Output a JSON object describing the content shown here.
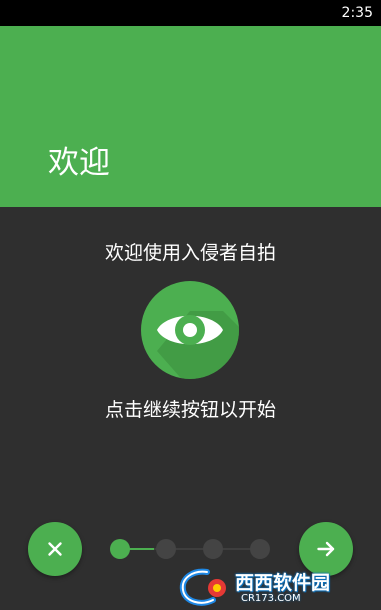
{
  "status_bar": {
    "time": "2:35"
  },
  "header": {
    "title": "欢迎"
  },
  "content": {
    "welcome_text": "欢迎使用入侵者自拍",
    "instruction_text": "点击继续按钮以开始",
    "logo_icon": "eye-icon"
  },
  "pager": {
    "total": 4,
    "current": 1
  },
  "buttons": {
    "skip_icon": "close-icon",
    "next_icon": "arrow-right-icon"
  },
  "watermark": {
    "brand": "西西软件园",
    "url": "CR173.COM"
  },
  "colors": {
    "accent": "#4caf50",
    "background": "#2f2f2f",
    "status_bar": "#000000",
    "dot_inactive": "#444444",
    "text": "#ffffff"
  }
}
